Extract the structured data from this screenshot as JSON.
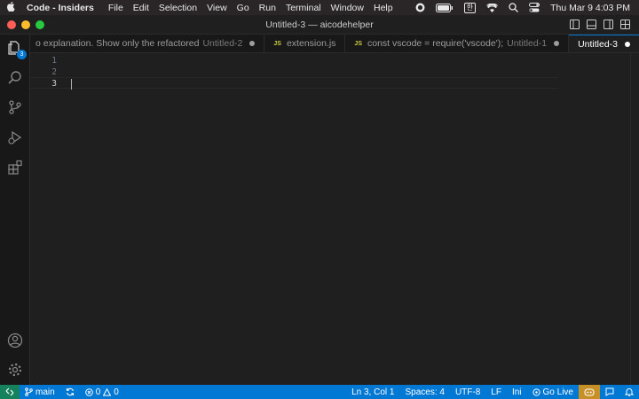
{
  "menubar": {
    "app_name": "Code - Insiders",
    "items": [
      "File",
      "Edit",
      "Selection",
      "View",
      "Go",
      "Run",
      "Terminal",
      "Window",
      "Help"
    ],
    "input_source": "한",
    "clock": "Thu Mar 9  4:03 PM"
  },
  "window": {
    "title": "Untitled-3 — aicodehelper"
  },
  "activity": {
    "explorer_badge": "3"
  },
  "tabs": [
    {
      "label": "o explanation. Show only the refactored",
      "desc": "Untitled-2",
      "modified": true,
      "js": false
    },
    {
      "label": "extension.js",
      "desc": "",
      "modified": false,
      "js": true,
      "js_label": "JS"
    },
    {
      "label": "const vscode = require('vscode');",
      "desc": "Untitled-1",
      "modified": true,
      "js": true,
      "js_label": "JS"
    },
    {
      "label": "Untitled-3",
      "desc": "",
      "modified": true,
      "js": false,
      "active": true
    }
  ],
  "editor": {
    "line_numbers": [
      "1",
      "2",
      "3"
    ],
    "current_line": 3
  },
  "statusbar": {
    "branch": "main",
    "errors": "0",
    "warnings": "0",
    "position": "Ln 3, Col 1",
    "spaces": "Spaces: 4",
    "encoding": "UTF-8",
    "eol": "LF",
    "language": "Ini",
    "golive": "Go Live"
  },
  "colors": {
    "accent": "#0078d4",
    "remote": "#16825d",
    "copilot": "#c69026"
  }
}
